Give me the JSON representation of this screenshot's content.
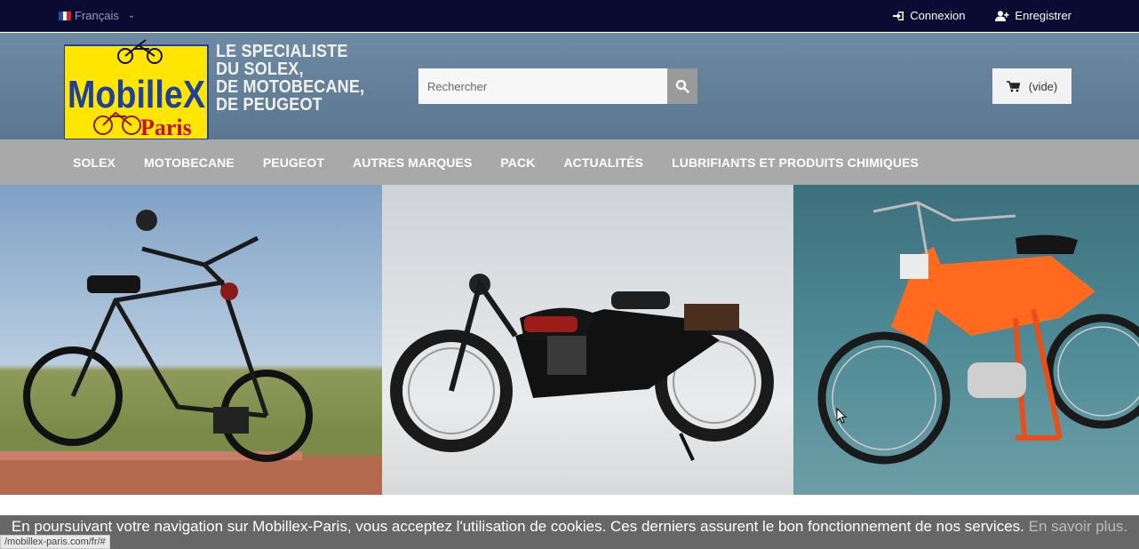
{
  "topbar": {
    "language": "Français",
    "login": "Connexion",
    "register": "Enregistrer",
    "flag_colors": [
      "#1f4fa3",
      "#ffffff",
      "#d7262e"
    ]
  },
  "header": {
    "logo_text_1": "MobilleX",
    "logo_text_2": "Paris",
    "tagline": [
      "LE SPECIALISTE",
      "DU SOLEX,",
      "DE MOTOBECANE,",
      "DE PEUGEOT"
    ],
    "search_placeholder": "Rechercher",
    "cart_label": "(vide)"
  },
  "nav": {
    "items": [
      "SOLEX",
      "MOTOBECANE",
      "PEUGEOT",
      "AUTRES MARQUES",
      "PACK",
      "ACTUALITÉS",
      "LUBRIFIANTS ET PRODUITS CHIMIQUES"
    ]
  },
  "cookie": {
    "message": "En poursuivant votre navigation sur Mobillex-Paris, vous acceptez l'utilisation de cookies. Ces derniers assurent le bon fonctionnement de nos services.",
    "more_link": "En savoir plus."
  },
  "status_url": "/mobillex-paris.com/fr/#",
  "colors": {
    "topbar": "#0a0a33",
    "header": "#6a859e",
    "nav": "#a9a9a9",
    "logo_yellow": "#ffe600",
    "logo_blue": "#1d3fa0",
    "logo_red": "#c8102e"
  }
}
